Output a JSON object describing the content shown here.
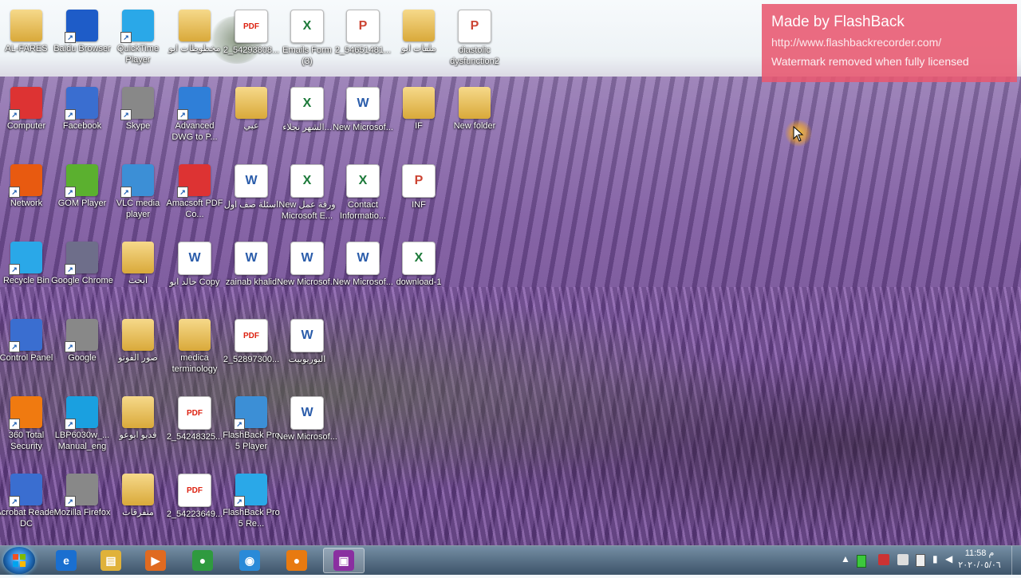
{
  "desktop_icons": [
    {
      "label": "AL-FARES",
      "kind": "folder"
    },
    {
      "label": "Baidu Browser",
      "kind": "app"
    },
    {
      "label": "QuickTime Player",
      "kind": "app"
    },
    {
      "label": "مخطوطات ابو",
      "kind": "folder"
    },
    {
      "label": "2_54293808...",
      "kind": "pdf"
    },
    {
      "label": "Emails Form (3)",
      "kind": "excel"
    },
    {
      "label": "2_54651481...",
      "kind": "ppt"
    },
    {
      "label": "ملفات ابو",
      "kind": "folder"
    },
    {
      "label": "diastolic dysfunction2",
      "kind": "ppt"
    },
    {
      "label": "Computer",
      "kind": "app"
    },
    {
      "label": "Facebook",
      "kind": "app"
    },
    {
      "label": "Skype",
      "kind": "app"
    },
    {
      "label": "Advanced DWG to P...",
      "kind": "app"
    },
    {
      "label": "عبي",
      "kind": "folder"
    },
    {
      "label": "الشهر نجلاء...",
      "kind": "excel"
    },
    {
      "label": "New Microsof...",
      "kind": "word"
    },
    {
      "label": "IF",
      "kind": "folder"
    },
    {
      "label": "New folder",
      "kind": "folder"
    },
    {
      "label": "Network",
      "kind": "app"
    },
    {
      "label": "GOM Player",
      "kind": "app"
    },
    {
      "label": "VLC media player",
      "kind": "app"
    },
    {
      "label": "Amacsoft PDF Co...",
      "kind": "app"
    },
    {
      "label": "اسئلة صف اول",
      "kind": "word"
    },
    {
      "label": "New ورقة عمل Microsoft E...",
      "kind": "excel"
    },
    {
      "label": "Contact Informatio...",
      "kind": "excel"
    },
    {
      "label": "INF",
      "kind": "ppt"
    },
    {
      "label": "Recycle Bin",
      "kind": "app"
    },
    {
      "label": "Google Chrome",
      "kind": "app"
    },
    {
      "label": "ابحث",
      "kind": "folder"
    },
    {
      "label": "خالد ابو Copy",
      "kind": "word"
    },
    {
      "label": "zainab khalid",
      "kind": "word"
    },
    {
      "label": "New Microsof...",
      "kind": "word"
    },
    {
      "label": "New Microsof...",
      "kind": "word"
    },
    {
      "label": "download-1",
      "kind": "excel"
    },
    {
      "label": "Control Panel",
      "kind": "app"
    },
    {
      "label": "Google",
      "kind": "app"
    },
    {
      "label": "صور الفوتو",
      "kind": "folder"
    },
    {
      "label": "medica terminology",
      "kind": "folder"
    },
    {
      "label": "2_52897300...",
      "kind": "pdf"
    },
    {
      "label": "اليوريوبيت",
      "kind": "word"
    },
    {
      "label": "360 Total Security",
      "kind": "app"
    },
    {
      "label": "LBP6030w_... Manual_eng",
      "kind": "app"
    },
    {
      "label": "فديو ابوعو",
      "kind": "folder"
    },
    {
      "label": "2_54248325...",
      "kind": "pdf"
    },
    {
      "label": "FlashBack Pro 5 Player",
      "kind": "app"
    },
    {
      "label": "New Microsof...",
      "kind": "word"
    },
    {
      "label": "Acrobat Reader DC",
      "kind": "app"
    },
    {
      "label": "Mozilla Firefox",
      "kind": "app"
    },
    {
      "label": "متفرقات",
      "kind": "folder"
    },
    {
      "label": "2_54223649...",
      "kind": "pdf"
    },
    {
      "label": "FlashBack Pro 5 Re...",
      "kind": "app"
    }
  ],
  "watermark": {
    "title": "Made by FlashBack",
    "url": "http://www.flashbackrecorder.com/",
    "note": "Watermark removed when fully licensed"
  },
  "taskbar": {
    "apps": [
      "Internet Explorer",
      "Windows Explorer",
      "Media Player",
      "Google Chrome",
      "Baidu Browser",
      "GOM Player",
      "FlashBack Pro 5 Recorder"
    ],
    "clock_time": "11:58 م",
    "clock_date": "٢٠٢٠/٠٥/٠٦"
  },
  "colors": {
    "watermark_bg": "#e85870",
    "taskbar": "#4f6f88"
  }
}
